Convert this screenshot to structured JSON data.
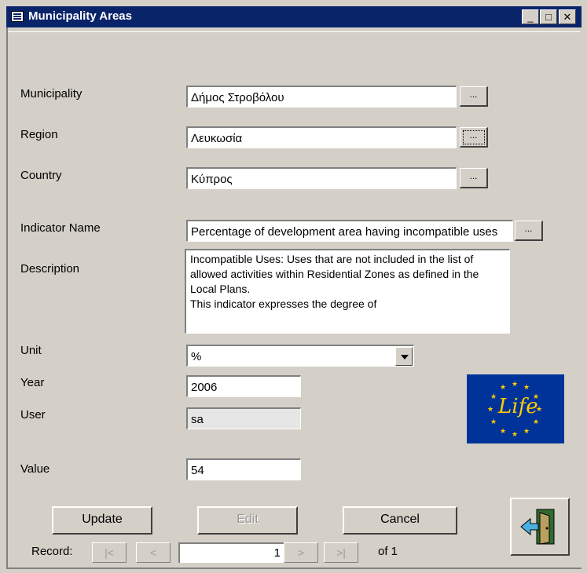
{
  "window": {
    "title": "Municipality Areas",
    "minimize": "_",
    "maximize": "□",
    "close": "✕"
  },
  "form": {
    "municipality": {
      "label": "Municipality",
      "value": "Δήμος Στροβόλου"
    },
    "region": {
      "label": "Region",
      "value": "Λευκωσία"
    },
    "country": {
      "label": "Country",
      "value": "Κύπρος"
    },
    "indicator": {
      "label": "Indicator Name",
      "value": "Percentage of development area having incompatible uses"
    },
    "description": {
      "label": "Description",
      "value": "Incompatible Uses: Uses that are not included in the list of allowed activities within Residential Zones as defined in the Local Plans.\nThis indicator expresses the degree of"
    },
    "unit": {
      "label": "Unit",
      "value": "%"
    },
    "year": {
      "label": "Year",
      "value": "2006"
    },
    "user": {
      "label": "User",
      "value": "sa"
    },
    "value": {
      "label": "Value",
      "value": "54"
    },
    "lookup_label": "..."
  },
  "logo": {
    "text": "Life"
  },
  "buttons": {
    "update": "Update",
    "edit": "Edit",
    "cancel": "Cancel"
  },
  "navigator": {
    "label": "Record:",
    "first": "|<",
    "prev": "<",
    "current": "1",
    "next": ">",
    "last": ">|",
    "total": "of 1"
  },
  "colors": {
    "titlebar": "#0a246a",
    "window": "#d4d0c8",
    "logo_bg": "#003399",
    "logo_star": "#ffcc00"
  }
}
